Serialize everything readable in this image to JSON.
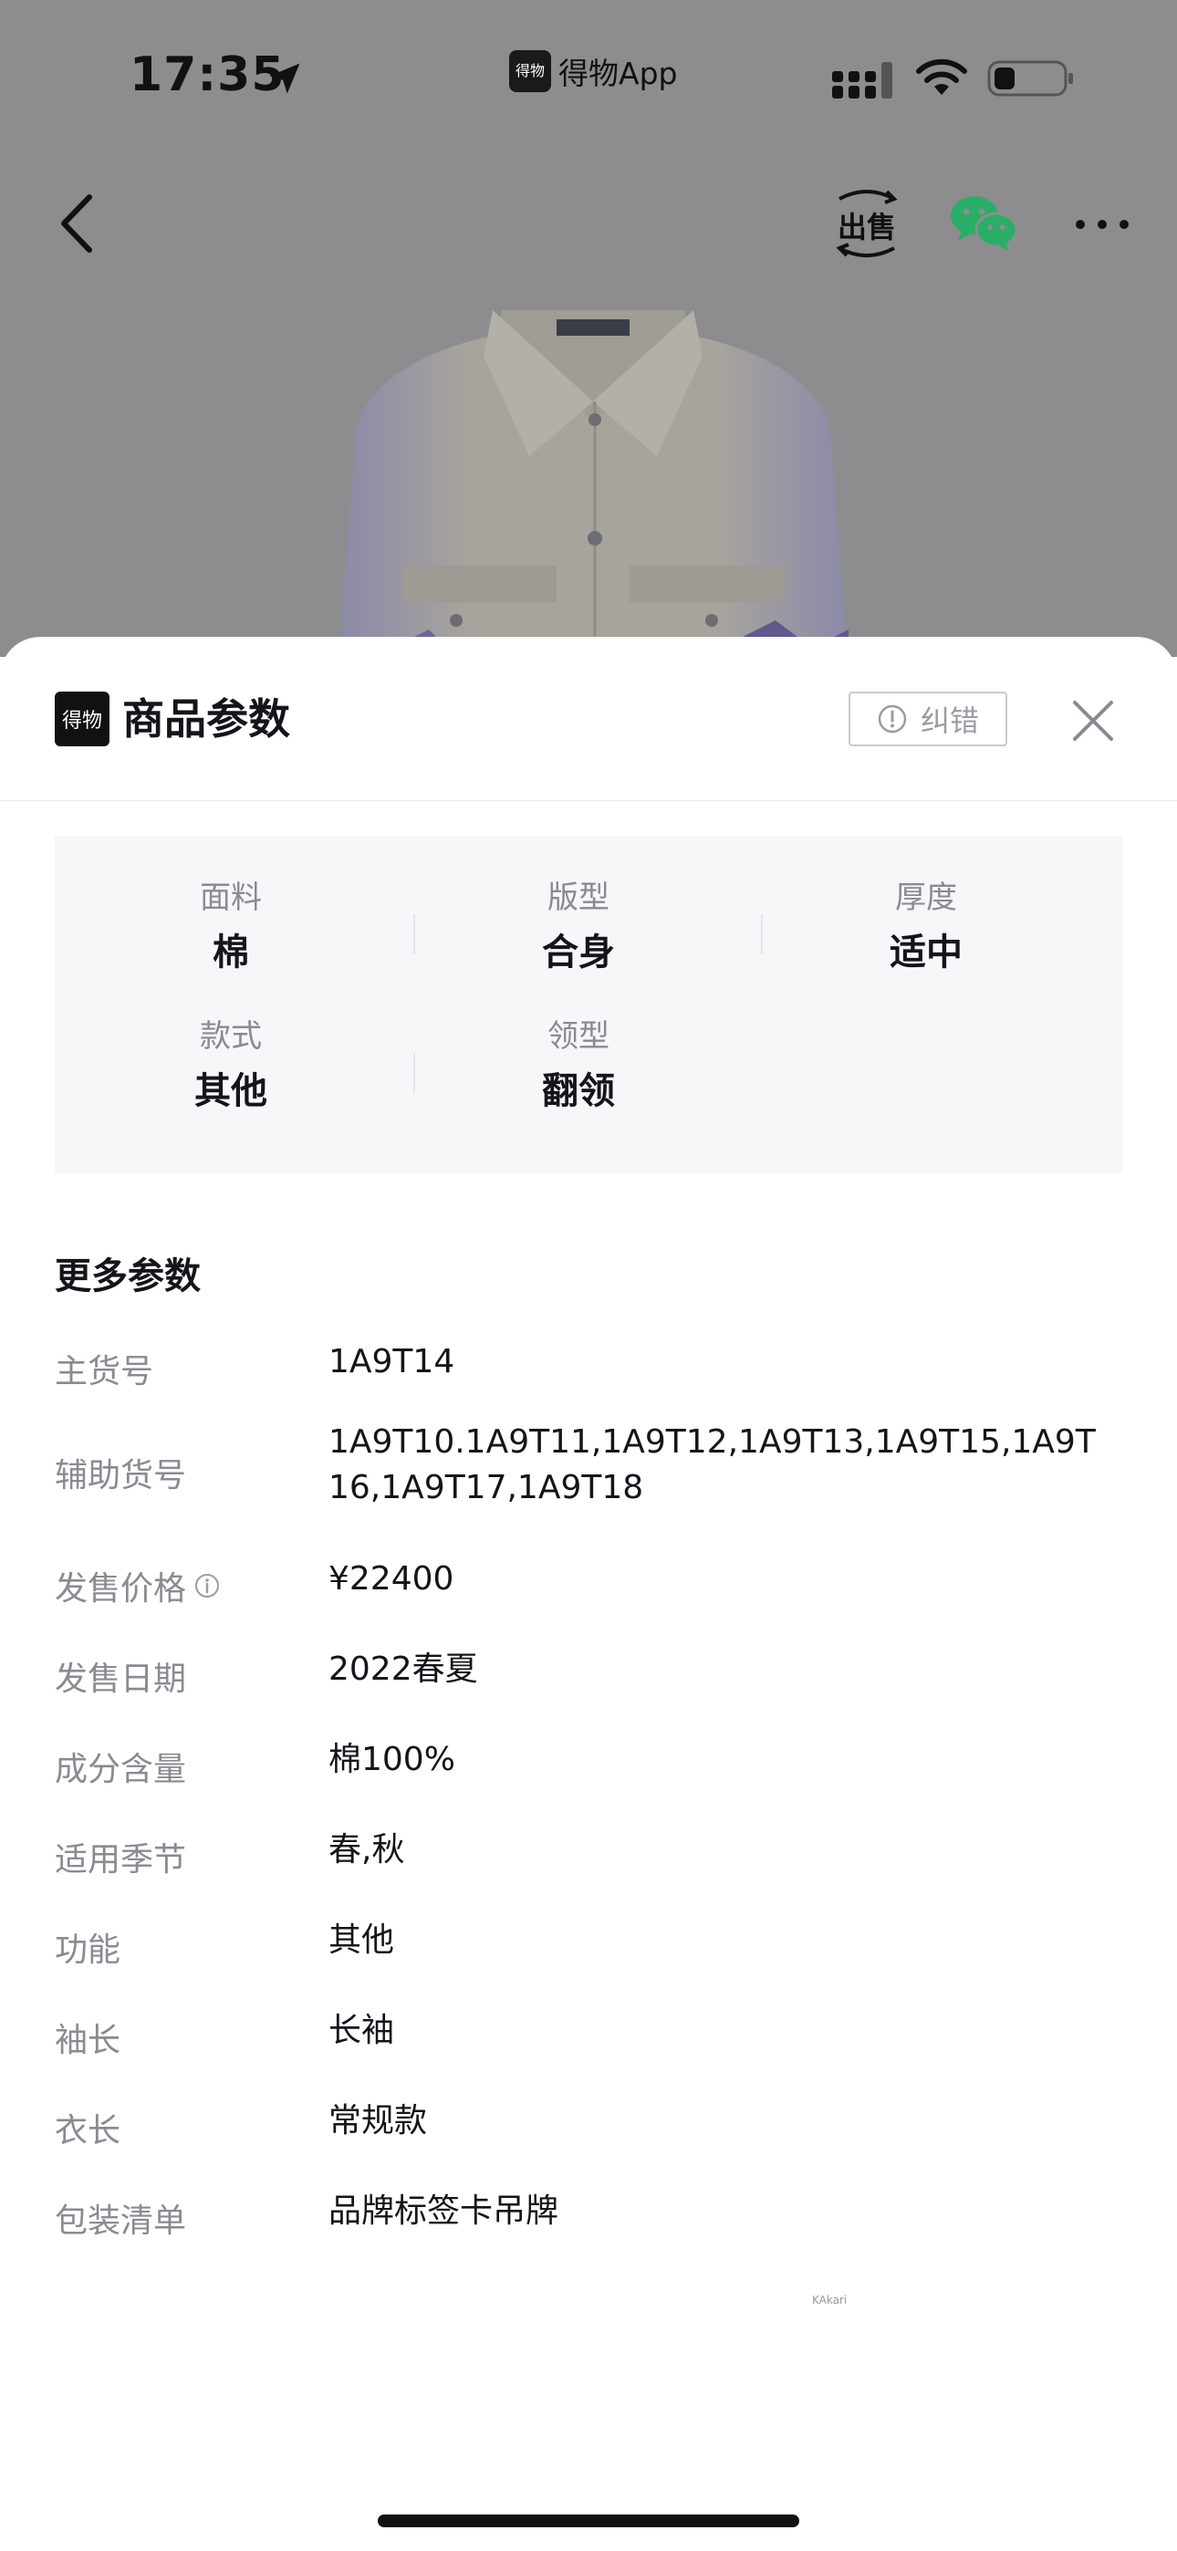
{
  "status_bar": {
    "time": "17:35",
    "app_name": "得物App",
    "app_logo_text": "得物"
  },
  "top_bar": {
    "sell_label": "出售"
  },
  "sheet": {
    "logo_text": "得物",
    "title": "商品参数",
    "report_label": "纠错",
    "attributes": [
      {
        "label": "面料",
        "value": "棉"
      },
      {
        "label": "版型",
        "value": "合身"
      },
      {
        "label": "厚度",
        "value": "适中"
      },
      {
        "label": "款式",
        "value": "其他"
      },
      {
        "label": "领型",
        "value": "翻领"
      }
    ],
    "more_title": "更多参数",
    "params": [
      {
        "label": "主货号",
        "value": "1A9T14"
      },
      {
        "label": "辅助货号",
        "value": "1A9T10.1A9T11,1A9T12,1A9T13,1A9T15,1A9T16,1A9T17,1A9T18"
      },
      {
        "label": "发售价格",
        "value": "¥22400"
      },
      {
        "label": "发售日期",
        "value": "2022春夏"
      },
      {
        "label": "成分含量",
        "value": "棉100%"
      },
      {
        "label": "适用季节",
        "value": "春,秋"
      },
      {
        "label": "功能",
        "value": "其他"
      },
      {
        "label": "袖长",
        "value": "长袖"
      },
      {
        "label": "衣长",
        "value": "常规款"
      },
      {
        "label": "包装清单",
        "value": "品牌标签卡吊牌"
      }
    ],
    "watermark": "KAkari"
  },
  "colors": {
    "backdrop": "#8d8d8f",
    "panel_bg": "#f6f7f9",
    "label_gray": "#8a8a92",
    "text_dark": "#14151a",
    "wechat_green": "#2aae67"
  }
}
